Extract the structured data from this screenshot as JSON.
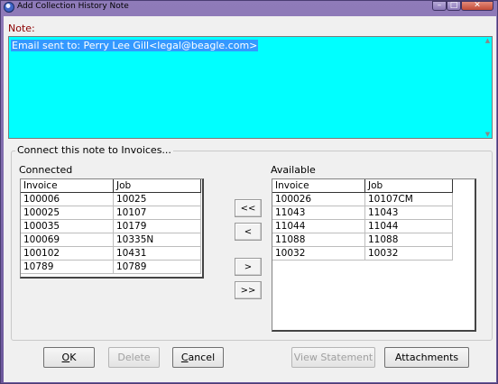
{
  "window": {
    "title": "Add Collection History Note",
    "controls": {
      "minimize": "–",
      "maximize": "□",
      "close": "✕"
    }
  },
  "note": {
    "label": "Note:",
    "text": "Email sent to: Perry Lee Gill<legal@beagle.com>"
  },
  "invoices": {
    "group_title": "Connect this note to Invoices...",
    "connected": {
      "label": "Connected",
      "columns": [
        "Invoice",
        "Job"
      ],
      "rows": [
        [
          "100006",
          "10025"
        ],
        [
          "100025",
          "10107"
        ],
        [
          "100035",
          "10179"
        ],
        [
          "100069",
          "10335N"
        ],
        [
          "100102",
          "10431"
        ],
        [
          "10789",
          "10789"
        ]
      ]
    },
    "available": {
      "label": "Available",
      "columns": [
        "Invoice",
        "Job"
      ],
      "rows": [
        [
          "100026",
          "10107CM"
        ],
        [
          "11043",
          "11043"
        ],
        [
          "11044",
          "11044"
        ],
        [
          "11088",
          "11088"
        ],
        [
          "10032",
          "10032"
        ]
      ]
    },
    "move_buttons": {
      "move_all_left": "<<",
      "move_left": "<",
      "move_right": ">",
      "move_all_right": ">>"
    }
  },
  "buttons": {
    "ok": {
      "label_underlined": "O",
      "label_rest": "K"
    },
    "delete": {
      "label": "Delete",
      "enabled": false
    },
    "cancel": {
      "label_underlined": "C",
      "label_rest": "ancel"
    },
    "view_statement": {
      "label": "View Statement",
      "enabled": false
    },
    "attachments": {
      "label": "Attachments"
    }
  }
}
